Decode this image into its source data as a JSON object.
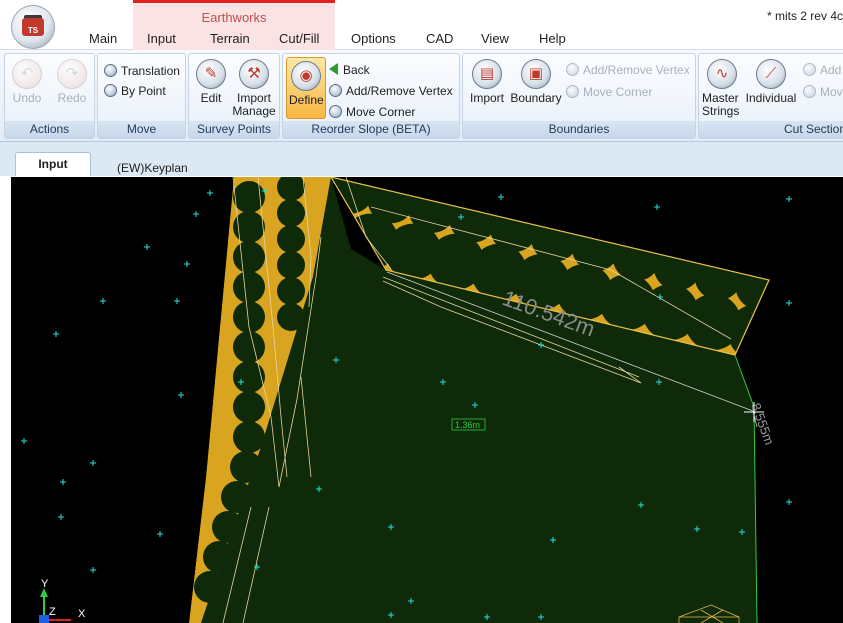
{
  "app": {
    "context_group_label": "Earthworks",
    "document_title": "* mits 2 rev 4c",
    "logo_text": "TS"
  },
  "ribbon_tabs": [
    "Main",
    "Input",
    "Terrain",
    "Cut/Fill",
    "Options",
    "CAD",
    "View",
    "Help"
  ],
  "groups": {
    "actions": {
      "caption": "Actions",
      "undo": "Undo",
      "redo": "Redo"
    },
    "move": {
      "caption": "Move",
      "translation": "Translation",
      "by_point": "By Point"
    },
    "survey_points": {
      "caption": "Survey Points",
      "edit": "Edit",
      "import_manage_1": "Import",
      "import_manage_2": "Manage"
    },
    "reorder_slope": {
      "caption": "Reorder Slope (BETA)",
      "define": "Define",
      "back": "Back",
      "add_remove_vertex": "Add/Remove Vertex",
      "move_corner": "Move Corner"
    },
    "boundaries": {
      "caption": "Boundaries",
      "import": "Import",
      "boundary": "Boundary",
      "add_remove_vertex": "Add/Remove Vertex",
      "move_corner": "Move Corner"
    },
    "cut_sections": {
      "caption": "Cut Section",
      "master_strings_1": "Master",
      "master_strings_2": "Strings",
      "individual": "Individual",
      "add": "Add",
      "move": "Mov"
    }
  },
  "doc_tabs": {
    "input": "Input",
    "keyplan": "(EW)Keyplan"
  },
  "viewport": {
    "dimension_main": "110.542m",
    "dimension_side": "8.555m",
    "area_label": "1.36m",
    "axis_y": "Y",
    "axis_z": "Z",
    "axis_x": "X",
    "colors": {
      "background": "#000000",
      "fill": "#0e2a08",
      "slope_fill": "#d9a520",
      "survey_point": "#22e0e0",
      "boundary": "#2ecc40"
    }
  }
}
